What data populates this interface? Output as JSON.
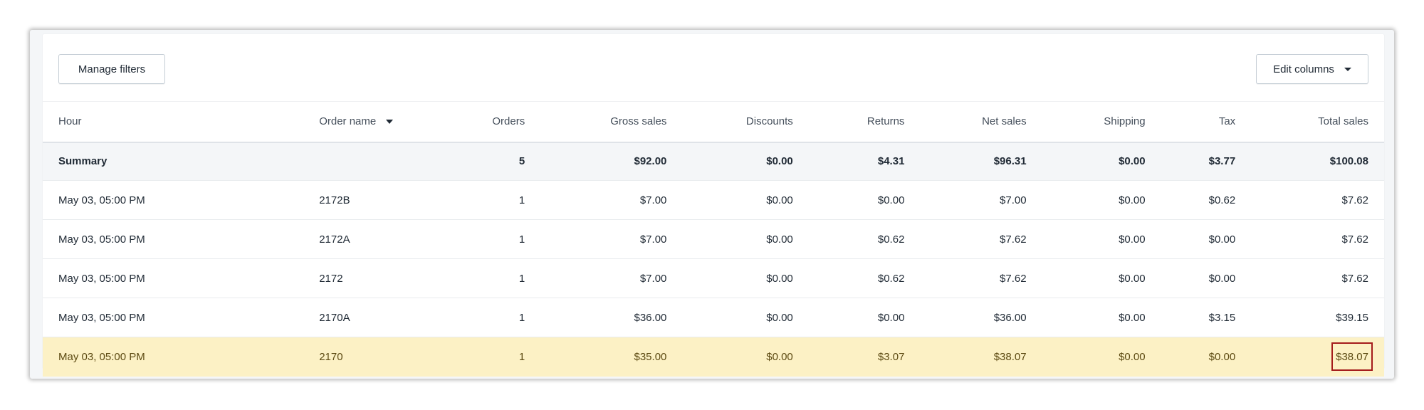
{
  "toolbar": {
    "manage_filters_label": "Manage filters",
    "edit_columns_label": "Edit columns"
  },
  "table": {
    "columns": [
      "Hour",
      "Order name",
      "Orders",
      "Gross sales",
      "Discounts",
      "Returns",
      "Net sales",
      "Shipping",
      "Tax",
      "Total sales"
    ],
    "sorted_column": "Order name",
    "summary": {
      "label": "Summary",
      "order_name": "",
      "orders": "5",
      "gross_sales": "$92.00",
      "discounts": "$0.00",
      "returns": "$4.31",
      "net_sales": "$96.31",
      "shipping": "$0.00",
      "tax": "$3.77",
      "total_sales": "$100.08"
    },
    "rows": [
      {
        "hour": "May 03, 05:00 PM",
        "order_name": "2172B",
        "orders": "1",
        "gross_sales": "$7.00",
        "discounts": "$0.00",
        "returns": "$0.00",
        "net_sales": "$7.00",
        "shipping": "$0.00",
        "tax": "$0.62",
        "total_sales": "$7.62"
      },
      {
        "hour": "May 03, 05:00 PM",
        "order_name": "2172A",
        "orders": "1",
        "gross_sales": "$7.00",
        "discounts": "$0.00",
        "returns": "$0.62",
        "net_sales": "$7.62",
        "shipping": "$0.00",
        "tax": "$0.00",
        "total_sales": "$7.62"
      },
      {
        "hour": "May 03, 05:00 PM",
        "order_name": "2172",
        "orders": "1",
        "gross_sales": "$7.00",
        "discounts": "$0.00",
        "returns": "$0.62",
        "net_sales": "$7.62",
        "shipping": "$0.00",
        "tax": "$0.00",
        "total_sales": "$7.62"
      },
      {
        "hour": "May 03, 05:00 PM",
        "order_name": "2170A",
        "orders": "1",
        "gross_sales": "$36.00",
        "discounts": "$0.00",
        "returns": "$0.00",
        "net_sales": "$36.00",
        "shipping": "$0.00",
        "tax": "$3.15",
        "total_sales": "$39.15"
      },
      {
        "hour": "May 03, 05:00 PM",
        "order_name": "2170",
        "orders": "1",
        "gross_sales": "$35.00",
        "discounts": "$0.00",
        "returns": "$3.07",
        "net_sales": "$38.07",
        "shipping": "$0.00",
        "tax": "$0.00",
        "total_sales": "$38.07"
      }
    ],
    "highlighted_row_index": 4
  },
  "colors": {
    "highlight_row": "#fcf1c5",
    "annotation_box": "#a41c1c",
    "summary_row": "#f4f6f8"
  },
  "icons": [
    "caret-down-icon",
    "sort-descending-icon"
  ]
}
